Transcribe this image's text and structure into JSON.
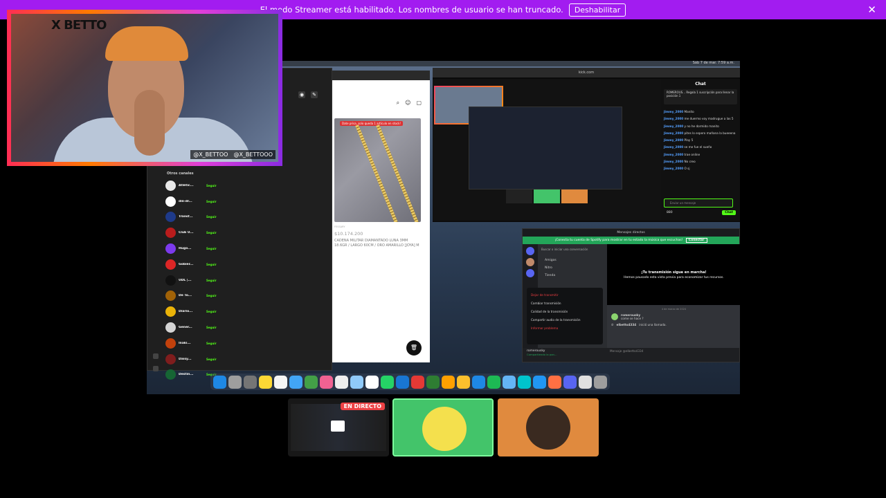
{
  "banner": {
    "message": "El modo Streamer está habilitado. Los nombres de usuario se han truncado.",
    "button": "Deshabilitar"
  },
  "webcam": {
    "logo": "X BETTO",
    "tiktok": "@X_BETTOO",
    "instagram": "@X_BETTOOO"
  },
  "screen": {
    "clock": "Sáb 7 de mar. 7:59 a.m.",
    "left_app": {
      "section_title": "Otros canales",
      "follow_label": "Seguir",
      "channels": [
        {
          "name": "Atlétic...",
          "color": "#e8e8e8"
        },
        {
          "name": "dm-dr...",
          "color": "#ffffff"
        },
        {
          "name": "Transf...",
          "color": "#1e3a8a"
        },
        {
          "name": "Club U...",
          "color": "#b91c1c"
        },
        {
          "name": "Hugo...",
          "color": "#7c3aed"
        },
        {
          "name": "Gobier...",
          "color": "#dc2626"
        },
        {
          "name": "UDL |...",
          "color": "#111111"
        },
        {
          "name": "De To...",
          "color": "#a16207"
        },
        {
          "name": "Diario...",
          "color": "#eab308"
        },
        {
          "name": "Gener...",
          "color": "#d4d4d4"
        },
        {
          "name": "Iñaki...",
          "color": "#c2410c"
        },
        {
          "name": "Daisy...",
          "color": "#7f1d1d"
        },
        {
          "name": "Destin...",
          "color": "#166534"
        }
      ]
    },
    "shop": {
      "badge": "Date prisa, solo queda 1 artículo en stock!",
      "brand": "FESSARY",
      "price": "$10.174.200",
      "description": "CADENA MILITAR DIAMANTADO LUNA 3MM 18.6GR / LARGO 60CM / ORO AMARILLO [JOYA] M"
    },
    "kick": {
      "url": "kick.com",
      "chat_title": "Chat",
      "pinned": "ROMEROUS... Regala 1 suscripción para llenar la posición 1",
      "messages": [
        {
          "user": "Jimmy_2000",
          "text": "Manito"
        },
        {
          "user": "Jimmy_2000",
          "text": "me duermo voy madrugue a las 5"
        },
        {
          "user": "Jimmy_2000",
          "text": "y no he dormido manito"
        },
        {
          "user": "Jimmy_2000",
          "text": "pites lo espero mañana la bueeena"
        },
        {
          "user": "Jimmy_2000",
          "text": "Play 5"
        },
        {
          "user": "Jimmy_2000",
          "text": "se me fue el sueño"
        },
        {
          "user": "Jimmy_2000",
          "text": "trae online"
        },
        {
          "user": "Jimmy_2000",
          "text": "No creo"
        },
        {
          "user": "Jimmy_2000",
          "text": "O sj"
        }
      ],
      "input_placeholder": "Enviar un mensaje",
      "send": "Chat",
      "points": "880"
    },
    "discord": {
      "title": "Mensajes directos",
      "notice": "¡Conecta tu cuenta de Spotify para mostrar en tu estado la música que escuchas!",
      "notice_button": "Conectar",
      "search": "Buscar o iniciar una conversación",
      "nav": [
        "Amigos",
        "Nitro",
        "Tienda"
      ],
      "menu": [
        {
          "label": "Dejar de transmitir",
          "red": true
        },
        {
          "label": "Cambiar transmisión",
          "red": false
        },
        {
          "label": "Calidad de la transmisión",
          "red": false
        },
        {
          "label": "Compartir audio de la transmisión",
          "red": false
        },
        {
          "label": "Informar problema",
          "red": true
        }
      ],
      "preview_title": "¡Tu transmisión sigue en marcha!",
      "preview_sub": "Hemos pausado esta vista previa para economizar tus recursos.",
      "date": "4 de marzo de 2024",
      "chat_user1": "romerousky",
      "chat_msg1": "come se hace ?",
      "chat_user2": "elbetto4334",
      "chat_msg2": "inició una llamada.",
      "input": "Mensaje @elbetto4334",
      "user": "romerousky",
      "user_status": "Compartiendo la pan..."
    }
  },
  "tiles": {
    "live_badge": "EN DIRECTO"
  },
  "colors": {
    "banner": "#a21cf0",
    "kick_green": "#53fc18",
    "discord_green": "#23a559"
  }
}
